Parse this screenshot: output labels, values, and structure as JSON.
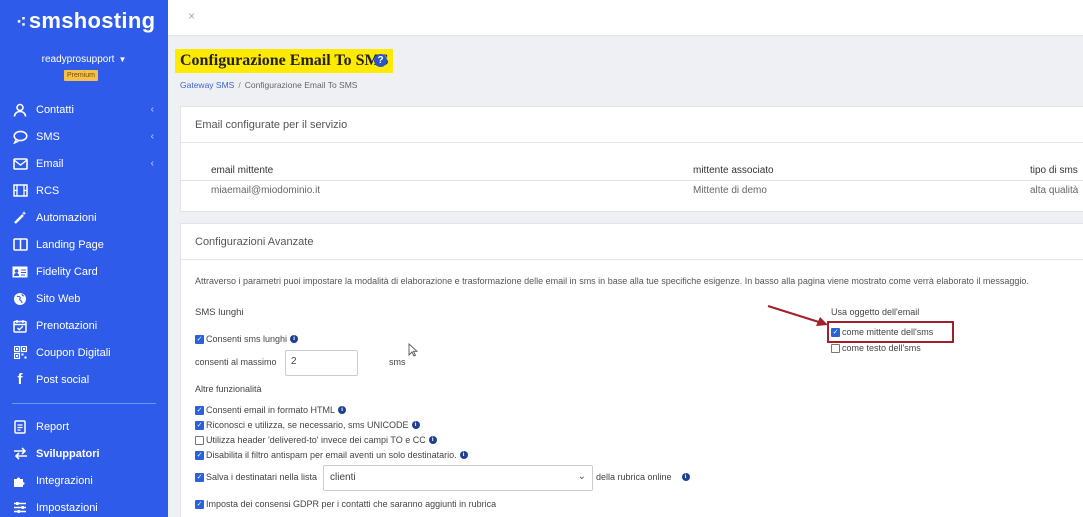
{
  "brand": {
    "logo_dots": "⁖",
    "logo_text": "smshosting"
  },
  "user": {
    "name": "readyprosupport",
    "caret": "▼",
    "plan_badge": "Premium"
  },
  "sidebar": {
    "items": [
      {
        "label": "Contatti",
        "icon": "user-icon",
        "glyph": "✦",
        "chevron": "‹"
      },
      {
        "label": "SMS",
        "icon": "chat-bubble-icon",
        "glyph": "◯",
        "chevron": "‹"
      },
      {
        "label": "Email",
        "icon": "envelope-icon",
        "glyph": "✉",
        "chevron": "‹"
      },
      {
        "label": "RCS",
        "icon": "film-icon",
        "glyph": "▦",
        "chevron": ""
      },
      {
        "label": "Automazioni",
        "icon": "magic-wand-icon",
        "glyph": "✨",
        "chevron": ""
      },
      {
        "label": "Landing Page",
        "icon": "columns-icon",
        "glyph": "◫",
        "chevron": ""
      },
      {
        "label": "Fidelity Card",
        "icon": "id-card-icon",
        "glyph": "▤",
        "chevron": ""
      },
      {
        "label": "Sito Web",
        "icon": "globe-icon",
        "glyph": "●",
        "chevron": ""
      },
      {
        "label": "Prenotazioni",
        "icon": "calendar-check-icon",
        "glyph": "☑",
        "chevron": ""
      },
      {
        "label": "Coupon Digitali",
        "icon": "qr-code-icon",
        "glyph": "▩",
        "chevron": ""
      },
      {
        "label": "Post social",
        "icon": "facebook-icon",
        "glyph": "f",
        "chevron": ""
      }
    ],
    "bottom_items": [
      {
        "label": "Report",
        "icon": "report-icon",
        "glyph": "▤"
      },
      {
        "label": "Sviluppatori",
        "icon": "exchange-icon",
        "glyph": "⇄"
      },
      {
        "label": "Integrazioni",
        "icon": "puzzle-icon",
        "glyph": "❖"
      },
      {
        "label": "Impostazioni",
        "icon": "sliders-icon",
        "glyph": "☰"
      }
    ]
  },
  "topbar": {
    "close_glyph": "×"
  },
  "page": {
    "title": "Configurazione Email To SMS",
    "help_glyph": "?",
    "breadcrumb": {
      "parent": "Gateway SMS",
      "separator": "/",
      "current": "Configurazione Email To SMS"
    }
  },
  "email_panel": {
    "title": "Email configurate per il servizio",
    "columns": [
      "email mittente",
      "mittente associato",
      "tipo di sms"
    ],
    "rows": [
      [
        "miaemail@miodominio.it",
        "Mittente di demo",
        "alta qualità"
      ]
    ]
  },
  "advanced_panel": {
    "title": "Configurazioni Avanzate",
    "intro": "Attraverso i parametri puoi impostare la modalità di elaborazione e trasformazione delle email in sms in base alla tue specifiche esigenze. In basso alla pagina viene mostrato come verrà elaborato il messaggio.",
    "sms_lunghi": {
      "heading": "SMS lunghi",
      "allow_label": "Consenti sms lunghi",
      "allow_checked": true,
      "max_label": "consenti al massimo",
      "max_value": "2",
      "max_unit": "sms"
    },
    "altre": {
      "heading": "Altre funzionalità",
      "options": [
        {
          "label": "Consenti email in formato HTML",
          "checked": true
        },
        {
          "label": "Riconosci e utilizza, se necessario, sms UNICODE",
          "checked": true
        },
        {
          "label": "Utilizza header 'delivered-to' invece dei campi TO e CC",
          "checked": false
        },
        {
          "label": "Disabilita il filtro antispam per email aventi un solo destinatario.",
          "checked": true
        }
      ],
      "save_label": "Salva i destinatari nella lista",
      "save_checked": true,
      "list_value": "clienti",
      "list_suffix": "della rubrica online",
      "gdpr_label": "Imposta dei consensi GDPR per i contatti che saranno aggiunti in rubrica",
      "gdpr_checked": true
    },
    "subject": {
      "heading": "Usa oggetto dell'email",
      "options": [
        {
          "label": "come mittente dell'sms",
          "checked": true
        },
        {
          "label": "come testo dell'sms",
          "checked": false
        }
      ]
    }
  },
  "colors": {
    "sidebar": "#2f5bea",
    "title_highlight": "#ffea00",
    "annotation": "#a1202c",
    "checkbox": "#2a62d8"
  }
}
